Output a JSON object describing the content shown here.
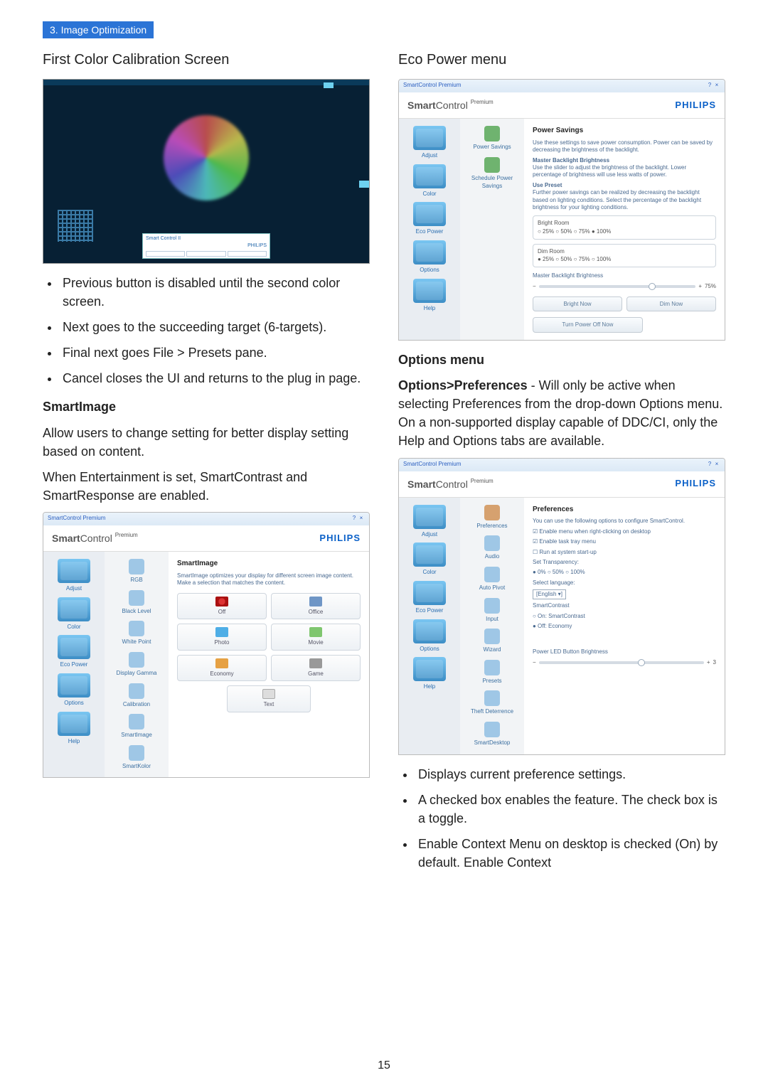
{
  "section_tag": "3. Image Optimization",
  "page_number": "15",
  "left": {
    "heading": "First Color Calibration Screen",
    "calib_label_line1": "Smart Control II",
    "calib_label_line2": "PHILIPS",
    "bullets": [
      "Previous button is disabled until the second color screen.",
      "Next goes to the succeeding target (6-targets).",
      "Final next goes File > Presets pane.",
      "Cancel closes the UI and returns to the plug in page."
    ],
    "smartimage_heading": "SmartImage",
    "smartimage_p1": "Allow users to change setting for better display setting based on content.",
    "smartimage_p2": "When Entertainment is set, SmartContrast and SmartResponse are enabled.",
    "panel": {
      "titlebar": "SmartControl Premium",
      "sc_bold": "Smart",
      "sc_rest": "Control",
      "sc_sup": "Premium",
      "philips": "PHILIPS",
      "sidebar": [
        "Adjust",
        "Color",
        "Eco Power",
        "Options",
        "Help"
      ],
      "subsidebar": [
        "RGB",
        "Black Level",
        "White Point",
        "Display Gamma",
        "Calibration",
        "SmartImage",
        "SmartKolor"
      ],
      "content_title": "SmartImage",
      "content_desc": "SmartImage optimizes your display for different screen image content. Make a selection that matches the content.",
      "tiles": [
        "Off",
        "Office",
        "Photo",
        "Movie",
        "Economy",
        "Game",
        "Text"
      ]
    }
  },
  "right": {
    "heading": "Eco Power menu",
    "panel1": {
      "titlebar": "SmartControl Premium",
      "sc_bold": "Smart",
      "sc_rest": "Control",
      "sc_sup": "Premium",
      "philips": "PHILIPS",
      "sidebar": [
        "Adjust",
        "Color",
        "Eco Power",
        "Options",
        "Help"
      ],
      "subsidebar": [
        "Power Savings",
        "Schedule Power Savings"
      ],
      "content_title": "Power Savings",
      "desc1": "Use these settings to save power consumption. Power can be saved by decreasing the brightness of the backlight.",
      "desc2_h": "Master Backlight Brightness",
      "desc2": "Use the slider to adjust the brightness of the backlight. Lower percentage of brightness will use less watts of power.",
      "desc3_h": "Use Preset",
      "desc3": "Further power savings can be realized by decreasing the backlight based on lighting conditions. Select the percentage of the backlight brightness for your lighting conditions.",
      "fs1_label": "Bright Room",
      "fs1_opts": "○ 25%  ○ 50%  ○ 75%  ● 100%",
      "fs2_label": "Dim Room",
      "fs2_opts": "● 25%  ○ 50%  ○ 75%  ○ 100%",
      "slider_label": "Master Backlight Brightness",
      "slider_val": "75%",
      "btn1": "Bright Now",
      "btn2": "Dim Now",
      "btn3": "Turn Power Off Now"
    },
    "options_heading": "Options menu",
    "options_para_bold": "Options>Preferences",
    "options_para_rest": " - Will only be active when selecting Preferences from the drop-down Options menu. On a non-supported display capable of DDC/CI, only the Help and Options tabs are available.",
    "panel2": {
      "titlebar": "SmartControl Premium",
      "sc_bold": "Smart",
      "sc_rest": "Control",
      "sc_sup": "Premium",
      "philips": "PHILIPS",
      "sidebar": [
        "Adjust",
        "Color",
        "Eco Power",
        "Options",
        "Help"
      ],
      "subsidebar": [
        "Preferences",
        "Audio",
        "Auto Pivot",
        "Input",
        "Wizard",
        "Presets",
        "Theft Deterrence",
        "SmartDesktop"
      ],
      "content_title": "Preferences",
      "lines": [
        "You can use the following options to configure SmartControl.",
        "☑ Enable menu when right-clicking on desktop",
        "☑ Enable task tray menu",
        "☐ Run at system start-up",
        "Set Transparency:",
        "● 0%  ○ 50%  ○ 100%",
        "Select language:",
        "[English ▾]",
        "SmartContrast",
        "○ On: SmartContrast",
        "● Off: Economy"
      ],
      "slider_label": "Power LED Button Brightness",
      "slider_val": "3"
    },
    "bullets": [
      "Displays current preference settings.",
      "A checked box enables the feature. The check box is a toggle.",
      "Enable Context Menu on desktop is checked (On) by default. Enable Context"
    ]
  }
}
